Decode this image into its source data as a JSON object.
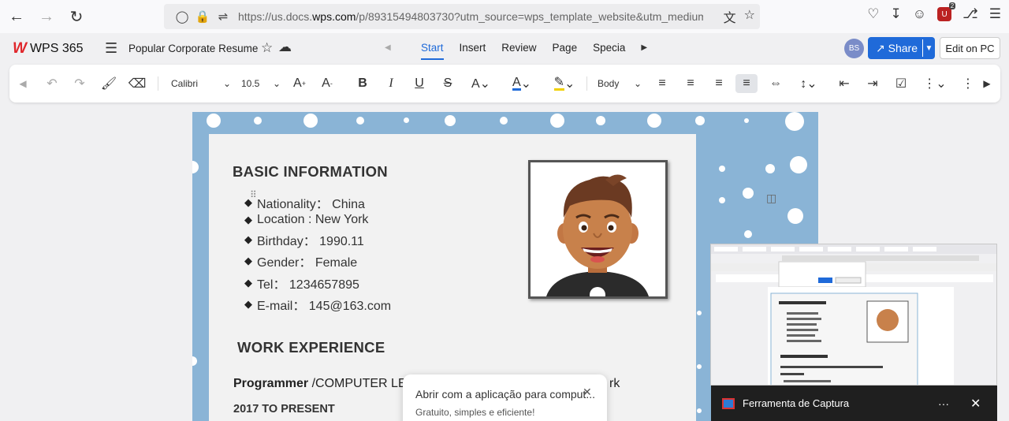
{
  "browser": {
    "url_prefix": "https://us.docs.",
    "url_domain": "wps.com",
    "url_rest": "/p/89315494803730?utm_source=wps_template_website&utm_medium"
  },
  "app": {
    "logo_text": "WPS 365",
    "doc_title": "Popular Corporate Resume",
    "tabs": [
      "Start",
      "Insert",
      "Review",
      "Page",
      "Specia"
    ],
    "avatar_initials": "BS",
    "share_label": "Share",
    "edit_pc_label": "Edit on PC"
  },
  "toolbar": {
    "font": "Calibri",
    "size": "10.5",
    "style": "Body"
  },
  "document": {
    "basic_title": "BASIC INFORMATION",
    "info": [
      "Nationality： China",
      "Location : New York",
      "Birthday： 1990.11",
      "Gender：  Female",
      "Tel： 1234657895",
      "E-mail： 145@163.com"
    ],
    "work_title": "WORK EXPERIENCE",
    "job_role": "Programmer",
    "job_rest": " /COMPUTER LEV",
    "job_tail": "rk",
    "date": "2017 TO PRESENT"
  },
  "popup": {
    "title": "Abrir com a aplicação para comput...",
    "subtitle": "Gratuito, simples e eficiente!"
  },
  "snip": {
    "title": "Ferramenta de Captura"
  },
  "colors": {
    "accent": "#1f6ad9",
    "page_bg": "#8ab4d6",
    "logo_red": "#e0262b"
  }
}
